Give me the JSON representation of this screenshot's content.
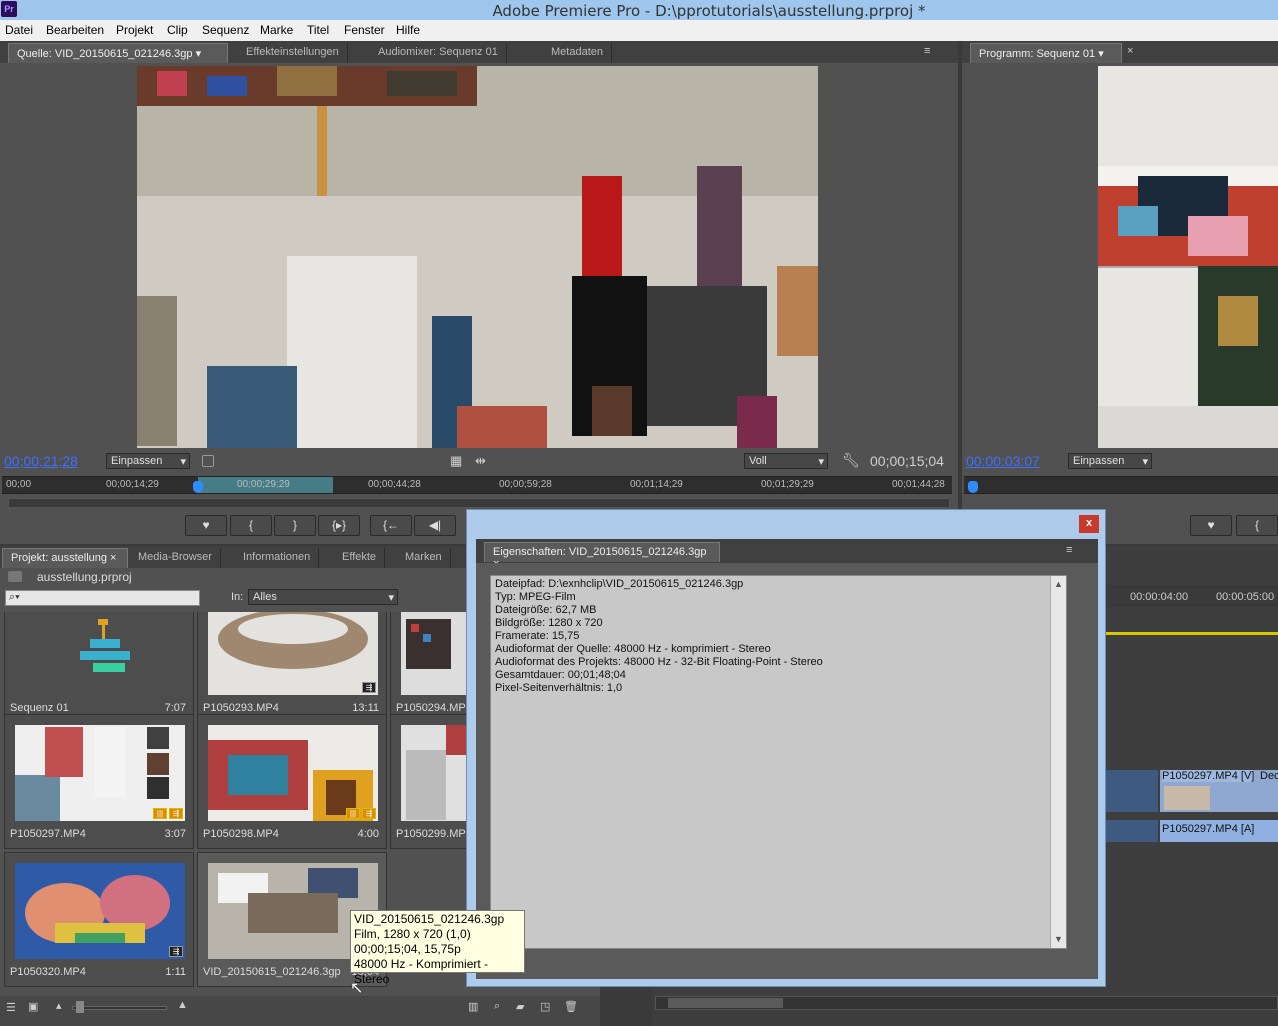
{
  "window": {
    "title": "Adobe Premiere Pro - D:\\pprotutorials\\ausstellung.prproj *",
    "logo": "Pr"
  },
  "menu": [
    "Datei",
    "Bearbeiten",
    "Projekt",
    "Clip",
    "Sequenz",
    "Marke",
    "Titel",
    "Fenster",
    "Hilfe"
  ],
  "source": {
    "tabs": [
      "Quelle: VID_20150615_021246.3gp",
      "Effekteinstellungen",
      "Audiomixer: Sequenz 01",
      "Metadaten"
    ],
    "timecode": "00;00;21;28",
    "zoom": "Einpassen",
    "quality": "Voll",
    "duration": "00;00;15;04",
    "ruler": [
      "00;00",
      "00;00;14;29",
      "00;00;29;29",
      "00;00;44;28",
      "00;00;59;28",
      "00;01;14;29",
      "00;01;29;29",
      "00;01;44;28"
    ]
  },
  "program": {
    "tab": "Programm: Sequenz 01",
    "timecode": "00:00:03:07",
    "zoom": "Einpassen"
  },
  "project": {
    "tabs": [
      "Projekt: ausstellung",
      "Media-Browser",
      "Informationen",
      "Effekte",
      "Marken"
    ],
    "filename": "ausstellung.prproj",
    "in_label": "In:",
    "in_value": "Alles",
    "items": [
      {
        "name": "Sequenz 01",
        "duration": "7:07"
      },
      {
        "name": "P1050293.MP4",
        "duration": "13:11"
      },
      {
        "name": "P1050294.MP4",
        "duration": ""
      },
      {
        "name": "P1050297.MP4",
        "duration": "3:07"
      },
      {
        "name": "P1050298.MP4",
        "duration": "4:00"
      },
      {
        "name": "P1050299.MP4",
        "duration": ""
      },
      {
        "name": "P1050320.MP4",
        "duration": "1:11"
      },
      {
        "name": "VID_20150615_021246.3gp",
        "duration": "15;04"
      }
    ]
  },
  "timeline": {
    "ruler": [
      "00:00:04:00",
      "00:00:05:00"
    ],
    "clip_video": "P1050297.MP4 [V]",
    "clip_video_extra": "Dec",
    "clip_audio": "P1050297.MP4 [A]"
  },
  "dialog": {
    "close": "x",
    "title": "Eigenschaften: VID_20150615_021246.3gp",
    "lines": [
      "Dateipfad: D:\\exnhclip\\VID_20150615_021246.3gp",
      "Typ: MPEG-Film",
      "Dateigröße: 62,7 MB",
      "Bildgröße: 1280 x 720",
      "Framerate: 15,75",
      "Audioformat der Quelle: 48000 Hz - komprimiert - Stereo",
      "Audioformat des Projekts: 48000 Hz - 32-Bit Floating-Point - Stereo",
      "Gesamtdauer: 00;01;48;04",
      "Pixel-Seitenverhältnis: 1,0"
    ]
  },
  "tooltip": [
    "VID_20150615_021246.3gp",
    "Film, 1280 x 720 (1,0)",
    "00;00;15;04, 15,75p",
    "48000 Hz - Komprimiert - Stereo"
  ],
  "colors": {
    "timecode": "#3f6fff",
    "titlebar": "#9fc6ec",
    "dialog_close": "#c7392b"
  }
}
